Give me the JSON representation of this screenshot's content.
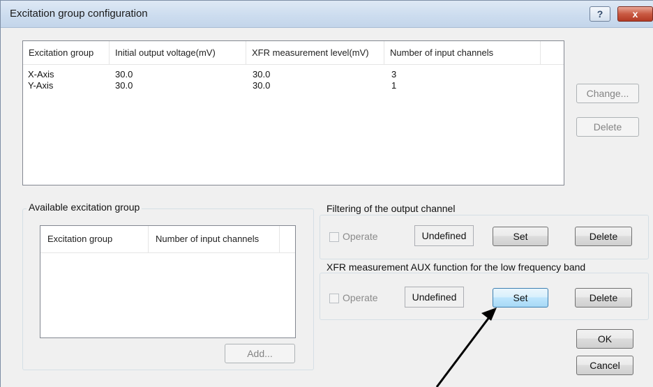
{
  "window": {
    "title": "Excitation group configuration",
    "help_label": "?",
    "close_label": "x"
  },
  "groups_table": {
    "headers": [
      "Excitation group",
      "Initial output voltage(mV)",
      "XFR measurement level(mV)",
      "Number of input channels"
    ],
    "rows": [
      [
        "X-Axis",
        "30.0",
        "30.0",
        "3"
      ],
      [
        "Y-Axis",
        "30.0",
        "30.0",
        "1"
      ]
    ]
  },
  "side_buttons": {
    "change_label": "Change...",
    "delete_label": "Delete"
  },
  "available": {
    "title": "Available excitation group",
    "headers": [
      "Excitation group",
      "Number of input channels"
    ],
    "add_label": "Add..."
  },
  "filtering": {
    "title": "Filtering of the output channel",
    "operate_label": "Operate",
    "status": "Undefined",
    "set_label": "Set",
    "delete_label": "Delete"
  },
  "aux": {
    "title": "XFR measurement AUX function for the low frequency band",
    "operate_label": "Operate",
    "status": "Undefined",
    "set_label": "Set",
    "delete_label": "Delete"
  },
  "footer": {
    "ok_label": "OK",
    "cancel_label": "Cancel"
  },
  "colors": {
    "titlebar": "#cdddef",
    "close": "#c95a43",
    "dialog_bg": "#f0f0f0",
    "hot_button": "#bee6fd"
  },
  "icons": {
    "help": "help-icon",
    "close": "close-icon",
    "annotation": "arrow-icon"
  }
}
